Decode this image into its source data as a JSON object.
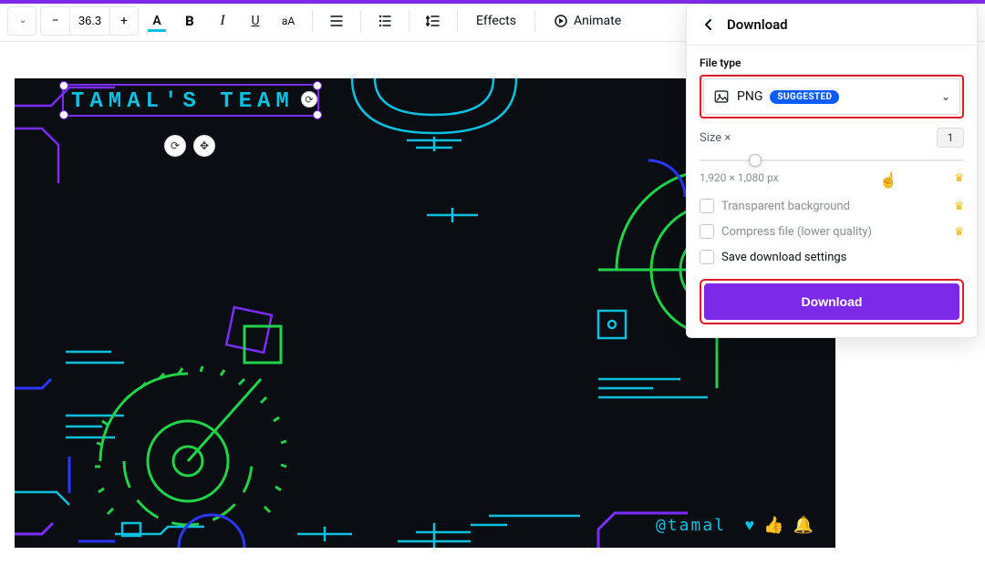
{
  "toolbar": {
    "font_size": "36.3",
    "effects_label": "Effects",
    "animate_label": "Animate"
  },
  "canvas": {
    "title_text": "TAMAL'S TEAM",
    "footer_handle": "@tamal"
  },
  "download": {
    "title": "Download",
    "file_type_label": "File type",
    "file_type_value": "PNG",
    "suggested_badge": "SUGGESTED",
    "size_label": "Size ×",
    "size_value": "1",
    "dimensions": "1,920 × 1,080 px",
    "opt_transparent": "Transparent background",
    "opt_compress": "Compress file (lower quality)",
    "opt_save": "Save download settings",
    "button_label": "Download"
  }
}
